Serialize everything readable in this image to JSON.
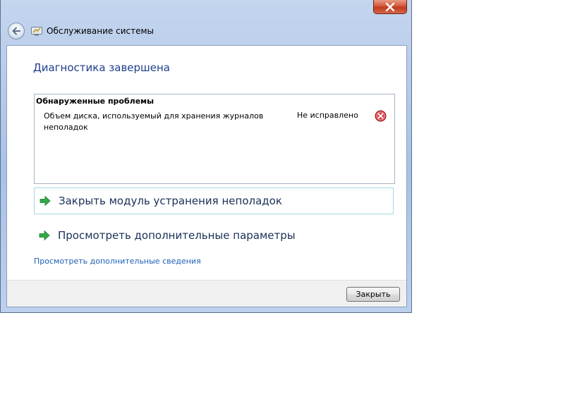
{
  "window": {
    "title": "Обслуживание системы",
    "icon": "system-maintenance-icon"
  },
  "main": {
    "heading": "Диагностика завершена",
    "problems": {
      "title": "Обнаруженные проблемы",
      "items": [
        {
          "text": "Объем диска, используемый для хранения журналов неполадок",
          "status": "Не исправлено",
          "status_icon": "error-icon"
        }
      ]
    },
    "commands": [
      {
        "label": "Закрыть модуль устранения неполадок",
        "icon": "green-arrow-icon"
      },
      {
        "label": "Просмотреть дополнительные параметры",
        "icon": "green-arrow-icon"
      }
    ],
    "details_link": "Просмотреть дополнительные сведения"
  },
  "footer": {
    "close_label": "Закрыть"
  },
  "colors": {
    "heading": "#1e3f8a",
    "link": "#1f5fb5",
    "command_text": "#1a2f56",
    "error": "#c7282e",
    "arrow": "#2aa33a"
  }
}
